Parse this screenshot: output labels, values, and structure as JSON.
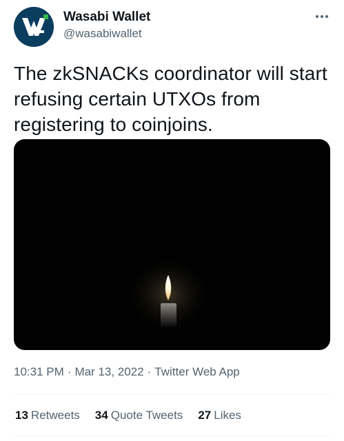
{
  "user": {
    "name": "Wasabi Wallet",
    "handle": "@wasabiwallet",
    "avatar_icon": "wasabi-logo-icon",
    "avatar_bg": "#0b3d5e",
    "avatar_accent": "#39b54a"
  },
  "tweet": {
    "text": "The zkSNACKs coordinator will start refusing certain UTXOs from registering to coinjoins.",
    "media_icon": "candle-image"
  },
  "meta": {
    "time": "10:31 PM",
    "date": "Mar 13, 2022",
    "separator": "·",
    "source": "Twitter Web App"
  },
  "stats": {
    "retweets_count": "13",
    "retweets_label": "Retweets",
    "quotes_count": "34",
    "quotes_label": "Quote Tweets",
    "likes_count": "27",
    "likes_label": "Likes"
  }
}
